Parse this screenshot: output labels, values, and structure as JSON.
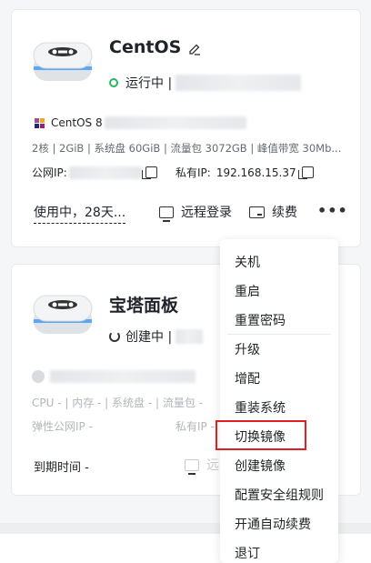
{
  "card1": {
    "title": "CentOS",
    "status_text": "运行中 |",
    "os_label": "CentOS 8",
    "specs": "2核 | 2GiB | 系统盘 60GiB | 流量包 3072GB | 峰值带宽 30Mb...",
    "public_ip_label": "公网IP:",
    "private_ip_label": "私有IP:",
    "private_ip_value": "192.168.15.37",
    "expiry_text": "使用中，28天...",
    "remote_login_label": "远程登录",
    "renew_label": "续费",
    "more_label": "•••"
  },
  "card2": {
    "title": "宝塔面板",
    "status_text": "创建中 |",
    "specs": "CPU - | 内存 - | 系统盘 - | 流量包 -",
    "elastic_ip_label": "弹性公网IP -",
    "private_ip_label": "私有IP -",
    "expiry_text": "到期时间 -",
    "remote_login_partial": "远"
  },
  "menu": {
    "items": [
      "关机",
      "重启",
      "重置密码",
      "升级",
      "增配",
      "重装系统",
      "切换镜像",
      "创建镜像",
      "配置安全组规则",
      "开通自动续费",
      "退订"
    ],
    "highlighted": "切换镜像"
  },
  "colors": {
    "running": "#2db55d",
    "highlight": "#e02020"
  }
}
